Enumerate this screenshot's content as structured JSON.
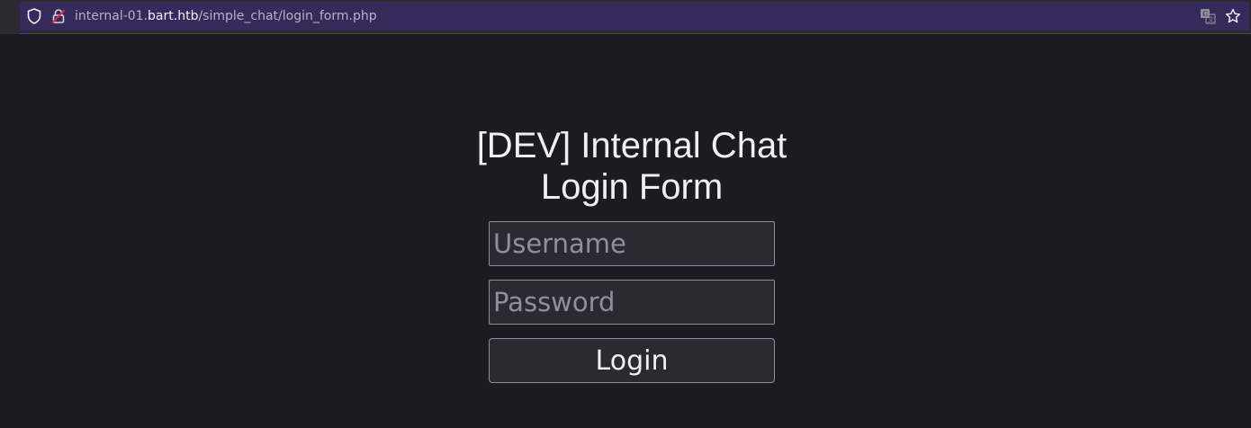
{
  "browser": {
    "url_prefix": "internal-01.",
    "url_host": "bart.htb",
    "url_path": "/simple_chat/login_form.php",
    "icons": {
      "shield": "shield-icon",
      "lock": "lock-icon",
      "translate": "translate-icon",
      "bookmark": "star-icon"
    }
  },
  "page": {
    "title_line1": "[DEV] Internal Chat",
    "title_line2": "Login Form",
    "username_placeholder": "Username",
    "username_value": "",
    "password_placeholder": "Password",
    "password_value": "",
    "login_label": "Login"
  },
  "colors": {
    "background": "#1c1b22",
    "urlbar": "#362a5a",
    "accent_lock": "#e22850"
  }
}
